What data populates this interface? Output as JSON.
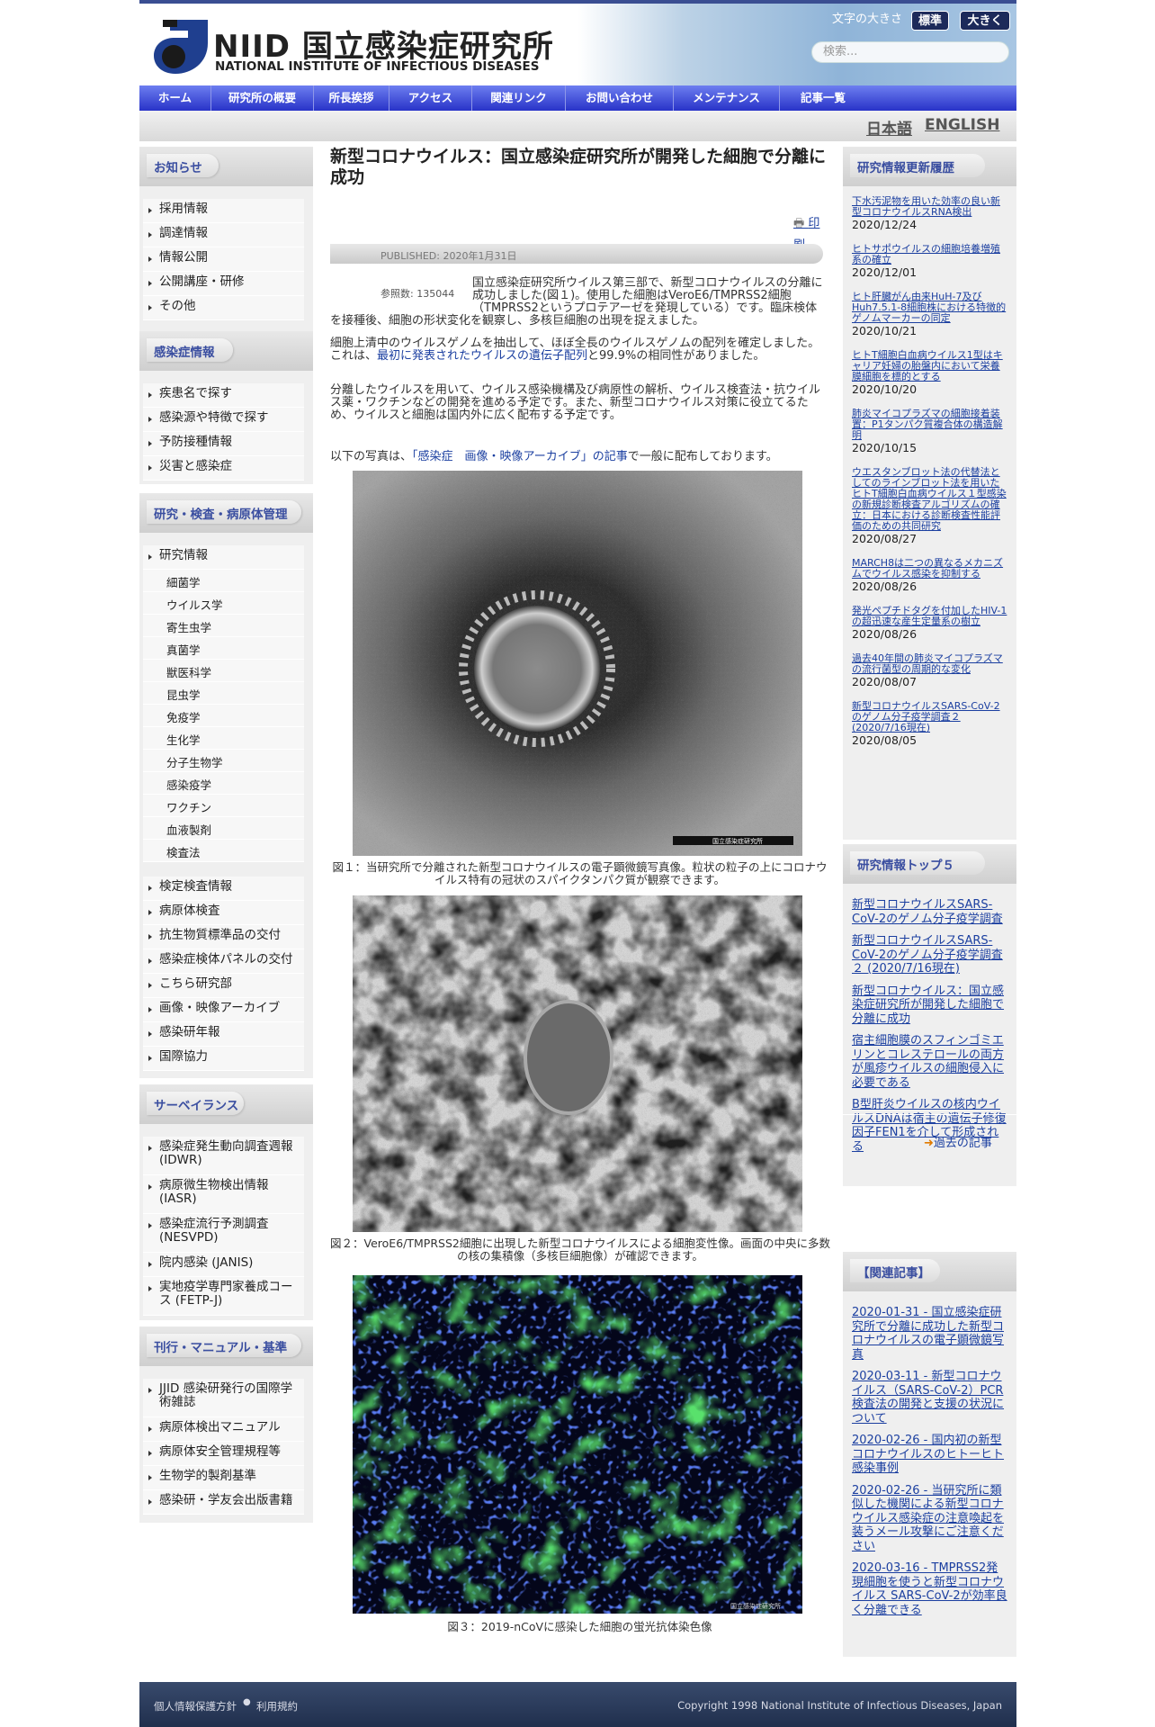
{
  "header": {
    "logo_text": "NIID 国立感染症研究所",
    "logo_sub": "NATIONAL INSTITUTE OF INFECTIOUS DISEASES",
    "font_size_label": "文字の大きさ",
    "font_standard": "標準",
    "font_large": "大きく",
    "search_placeholder": "検索..."
  },
  "nav": [
    "ホーム",
    "研究所の概要",
    "所長挨拶",
    "アクセス",
    "関連リンク",
    "お問い合わせ",
    "メンテナンス",
    "記事一覧"
  ],
  "lang": {
    "ja": "日本語",
    "en": "ENGLISH"
  },
  "left": {
    "notice": {
      "title": "お知らせ",
      "items": [
        "採用情報",
        "調達情報",
        "情報公開",
        "公開講座・研修",
        "その他"
      ]
    },
    "disease": {
      "title": "感染症情報",
      "items": [
        "疾患名で探す",
        "感染源や特徴で探す",
        "予防接種情報",
        "災害と感染症"
      ]
    },
    "research": {
      "title": "研究・検査・病原体管理",
      "head_item": "研究情報",
      "subs": [
        "細菌学",
        "ウイルス学",
        "寄生虫学",
        "真菌学",
        "獣医科学",
        "昆虫学",
        "免疫学",
        "生化学",
        "分子生物学",
        "感染疫学",
        "ワクチン",
        "血液製剤",
        "検査法"
      ],
      "items": [
        "検定検査情報",
        "病原体検査",
        "抗生物質標準品の交付",
        "感染症検体パネルの交付",
        "こちら研究部",
        "画像・映像アーカイブ",
        "感染研年報",
        "国際協力"
      ]
    },
    "surv": {
      "title": "サーベイランス",
      "items": [
        "感染症発生動向調査週報 (IDWR)",
        "病原微生物検出情報 (IASR)",
        "感染症流行予測調査 (NESVPD)",
        "院内感染 (JANIS)",
        "実地疫学専門家養成コース (FETP-J)"
      ]
    },
    "pub": {
      "title": "刊行・マニュアル・基準",
      "items": [
        "JJID 感染研発行の国際学術雑誌",
        "病原体検出マニュアル",
        "病原体安全管理規程等",
        "生物学的製剤基準",
        "感染研・学友会出版書籍"
      ]
    }
  },
  "article": {
    "title": "新型コロナウイルス：国立感染症研究所が開発した細胞で分離に成功",
    "print": "印刷",
    "published": "PUBLISHED: 2020年1月31日",
    "hits": "参照数: 135044",
    "p1": "国立感染症研究所ウイルス第三部で、新型コロナウイルスの分離に成功しました(図１)。使用した細胞はVeroE6/TMPRSS2細胞（TMPRSS2というプロテアーゼを発現している）です。臨床検体を接種後、細胞の形状変化を観察し、多核巨細胞の出現を捉えました。",
    "p2a": "細胞上清中のウイルスゲノムを抽出して、ほぼ全長のウイルスゲノムの配列を確定しました。これは、",
    "p2link": "最初に発表されたウイルスの遺伝子配列",
    "p2b": "と99.9%の相同性がありました。",
    "p3": "分離したウイルスを用いて、ウイルス感染機構及び病原性の解析、ウイルス検査法・抗ウイルス薬・ワクチンなどの開発を進める予定です。また、新型コロナウイルス対策に役立てるため、ウイルスと細胞は国内外に広く配布する予定です。",
    "p4a": "以下の写真は、",
    "p4link": "「感染症　画像・映像アーカイブ」の記事",
    "p4b": "で一般に配布しております。",
    "watermark": "国立感染症研究所",
    "cap1": "図１：当研究所で分離された新型コロナウイルスの電子顕微鏡写真像。粒状の粒子の上にコロナウイルス特有の冠状のスパイクタンパク質が観察できます。",
    "cap2": "図２：VeroE6/TMPRSS2細胞に出現した新型コロナウイルスによる細胞変性像。画面の中央に多数の核の集積像（多核巨細胞像）が確認できます。",
    "cap3": "図３：2019-nCoVに感染した細胞の蛍光抗体染色像"
  },
  "right": {
    "updates_title": "研究情報更新履歴",
    "updates": [
      {
        "t": "下水汚泥物を用いた効率の良い新型コロナウイルスRNA検出",
        "d": "2020/12/24"
      },
      {
        "t": "ヒトサポウイルスの細胞培養増殖系の確立",
        "d": "2020/12/01"
      },
      {
        "t": "ヒト肝臓がん由来HuH-7及びHuh7.5.1-8細胞株における特徴的ゲノムマーカーの同定",
        "d": "2020/10/21"
      },
      {
        "t": "ヒトT細胞白血病ウイルス1型はキャリア妊婦の胎盤内において栄養膜細胞を標的とする",
        "d": "2020/10/20"
      },
      {
        "t": "肺炎マイコプラズマの細胞接着装置：P1タンパク質複合体の構造解明",
        "d": "2020/10/15"
      },
      {
        "t": "ウエスタンブロット法の代替法としてのラインブロット法を用いたヒトT細胞白血病ウイルス１型感染の新規診断検査アルゴリズムの確立：日本における診断検査性能評価のための共同研究",
        "d": "2020/08/27"
      },
      {
        "t": "MARCH8は二つの異なるメカニズムでウイルス感染を抑制する",
        "d": "2020/08/26"
      },
      {
        "t": "発光ペプチドタグを付加したHIV-1の超迅速な産生定量系の樹立",
        "d": "2020/08/26"
      },
      {
        "t": "過去40年間の肺炎マイコプラズマの流行菌型の周期的な変化",
        "d": "2020/08/07"
      },
      {
        "t": "新型コロナウイルスSARS-CoV-2のゲノム分子疫学調査２ (2020/7/16現在)",
        "d": "2020/08/05"
      }
    ],
    "top5_title": "研究情報トップ５",
    "top5": [
      "新型コロナウイルスSARS-CoV-2のゲノム分子疫学調査",
      "新型コロナウイルスSARS-CoV-2のゲノム分子疫学調査２ (2020/7/16現在)",
      "新型コロナウイルス：国立感染症研究所が開発した細胞で分離に成功",
      "宿主細胞膜のスフィンゴミエリンとコレステロールの両方が風疹ウイルスの細胞侵入に必要である",
      "B型肝炎ウイルスの核内ウイルスDNAは宿主の遺伝子修復因子FEN1を介して形成される"
    ],
    "past": "過去の記事",
    "related_title": "【関連記事】",
    "related": [
      "2020-01-31 - 国立感染症研究所で分離に成功した新型コロナウイルスの電子顕微鏡写真",
      "2020-03-11 - 新型コロナウイルス（SARS-CoV-2）PCR検査法の開発と支援の状況について",
      "2020-02-26 - 国内初の新型コロナウイルスのヒトーヒト感染事例",
      "2020-02-26 - 当研究所に類似した機関による新型コロナウイルス感染症の注意喚起を装うメール攻撃にご注意ください",
      "2020-03-16 - TMPRSS2発現細胞を使うと新型コロナウイルス SARS-CoV-2が効率良く分離できる"
    ]
  },
  "footer": {
    "privacy": "個人情報保護方針",
    "terms": "利用規約",
    "copyright": "Copyright 1998 National Institute of Infectious Diseases, Japan"
  },
  "colors": {
    "nav": "#2833c8",
    "link": "#1b3fa0",
    "footer": "#202f4d"
  }
}
